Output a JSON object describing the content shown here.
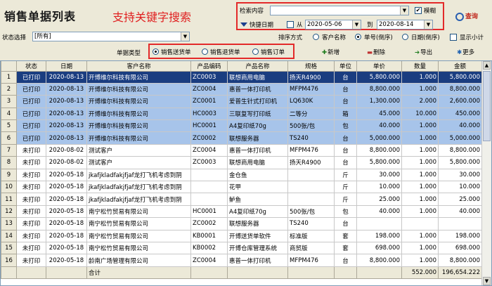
{
  "app": {
    "title": "销售单据列表"
  },
  "annotations": {
    "search": "支持关键字搜索"
  },
  "search": {
    "content_label": "检索内容",
    "content_value": "",
    "fuzzy_label": "模糊",
    "fuzzy_checked": true,
    "quick_date_label": "快捷日期",
    "from_label": "从",
    "from_date": "2020-05-06",
    "to_label": "到",
    "to_date": "2020-08-14",
    "query_label": "查询"
  },
  "filter": {
    "status_label": "状态选择",
    "status_value": "[所有]",
    "sort_label": "排序方式",
    "sort_options": [
      "客户名称",
      "单号(倒序)",
      "日期(倒序)"
    ],
    "sort_selected": 1,
    "show_subtotal_label": "显示小计"
  },
  "doc_type": {
    "label": "单据类型",
    "options": [
      "销售送货单",
      "销售退货单",
      "销售订单"
    ],
    "selected": 0
  },
  "toolbar": {
    "new": "新增",
    "delete": "删除",
    "export": "导出",
    "more": "更多"
  },
  "table": {
    "columns": [
      "状态",
      "日期",
      "客户名称",
      "产品编码",
      "产品名称",
      "规格",
      "单位",
      "单价",
      "数量",
      "金额"
    ],
    "rows": [
      [
        "1",
        "已打印",
        "2020-08-13",
        "开博维尔科技有限公司",
        "ZC0003",
        "联想商用电脑",
        "扬天R4900",
        "台",
        "5,800.000",
        "1.000",
        "5,800.000"
      ],
      [
        "2",
        "已打印",
        "2020-08-13",
        "开博维尔科技有限公司",
        "ZC0004",
        "惠普一体打印机",
        "MFPM476",
        "台",
        "8,800.000",
        "1.000",
        "8,800.000"
      ],
      [
        "3",
        "已打印",
        "2020-08-13",
        "开博维尔科技有限公司",
        "ZC0001",
        "爱普生针式打印机",
        "LQ630K",
        "台",
        "1,300.000",
        "2.000",
        "2,600.000"
      ],
      [
        "4",
        "已打印",
        "2020-08-13",
        "开博维尔科技有限公司",
        "HC0003",
        "三联复写打印纸",
        "二等分",
        "箱",
        "45.000",
        "10.000",
        "450.000"
      ],
      [
        "5",
        "已打印",
        "2020-08-13",
        "开博维尔科技有限公司",
        "HC0001",
        "A4复印纸70g",
        "500张/包",
        "包",
        "40.000",
        "1.000",
        "40.000"
      ],
      [
        "6",
        "已打印",
        "2020-08-13",
        "开博维尔科技有限公司",
        "ZC0002",
        "联想服务器",
        "TS240",
        "台",
        "5,000.000",
        "1.000",
        "5,000.000"
      ],
      [
        "7",
        "未打印",
        "2020-08-02",
        "测试客户",
        "ZC0004",
        "惠普一体打印机",
        "MFPM476",
        "台",
        "8,800.000",
        "1.000",
        "8,800.000"
      ],
      [
        "8",
        "未打印",
        "2020-08-02",
        "测试客户",
        "ZC0003",
        "联想商用电脑",
        "扬天R4900",
        "台",
        "5,800.000",
        "1.000",
        "5,800.000"
      ],
      [
        "9",
        "未打印",
        "2020-05-18",
        "jkafjkladfakjfjaf龙打飞机考虑到阴",
        "",
        "金仓鱼",
        "",
        "斤",
        "30.000",
        "1.000",
        "30.000"
      ],
      [
        "10",
        "未打印",
        "2020-05-18",
        "jkafjkladfakjfjaf龙打飞机考虑到阴",
        "",
        "花甲",
        "",
        "斤",
        "10.000",
        "1.000",
        "10.000"
      ],
      [
        "11",
        "未打印",
        "2020-05-18",
        "jkafjkladfakjfjaf龙打飞机考虑到阴",
        "",
        "鲈鱼",
        "",
        "斤",
        "25.000",
        "1.000",
        "25.000"
      ],
      [
        "12",
        "未打印",
        "2020-05-18",
        "南宁松竹贸易有限公司",
        "HC0001",
        "A4复印纸70g",
        "500张/包",
        "包",
        "40.000",
        "1.000",
        "40.000"
      ],
      [
        "13",
        "未打印",
        "2020-05-18",
        "南宁松竹贸易有限公司",
        "ZC0002",
        "联想服务器",
        "TS240",
        "台",
        "",
        "",
        ""
      ],
      [
        "14",
        "未打印",
        "2020-05-18",
        "南宁松竹贸易有限公司",
        "KB0001",
        "开博送货单软件",
        "标准版",
        "套",
        "198.000",
        "1.000",
        "198.000"
      ],
      [
        "15",
        "未打印",
        "2020-05-18",
        "南宁松竹贸易有限公司",
        "KB0002",
        "开博仓库管理系统",
        "商贸版",
        "套",
        "698.000",
        "1.000",
        "698.000"
      ],
      [
        "16",
        "未打印",
        "2020-05-18",
        "龄南广场管理有限公司",
        "ZC0004",
        "惠普一体打印机",
        "MFPM476",
        "台",
        "8,800.000",
        "1.000",
        "8,800.000"
      ]
    ],
    "total_label": "合计",
    "total_qty": "552.000",
    "total_amount": "196,654.222"
  }
}
